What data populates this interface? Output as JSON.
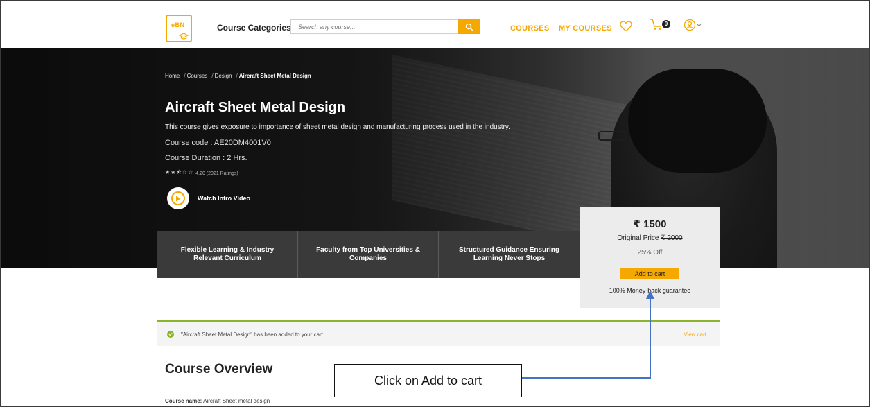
{
  "header": {
    "logo_text": "eBN",
    "categories_label": "Course Categories",
    "search_placeholder": "Search any course...",
    "nav_courses": "COURSES",
    "nav_my_courses": "MY COURSES",
    "cart_count": "0"
  },
  "breadcrumb": {
    "items": [
      "Home",
      "Courses",
      "Design"
    ],
    "current": "Aircraft Sheet Metal Design"
  },
  "course": {
    "title": "Aircraft Sheet Metal Design",
    "description": "This course gives exposure to importance of sheet metal design and manufacturing process used in the industry.",
    "code": "Course code : AE20DM4001V0",
    "duration": "Course Duration : 2 Hrs.",
    "stars": "★★⯪☆☆",
    "rating_value": 2.5,
    "rating_text": "4.20 (2021 Ratings)",
    "watch_label": "Watch Intro Video"
  },
  "features": [
    "Flexible Learning & Industry Relevant Curriculum",
    "Faculty from Top Universities & Companies",
    "Structured Guidance Ensuring Learning Never Stops"
  ],
  "price": {
    "current": "₹ 1500",
    "original_label": "Original Price",
    "original_value": "₹ 2000",
    "discount": "25% Off",
    "add_to_cart": "Add to cart",
    "guarantee": "100% Money-back guarantee"
  },
  "notice": {
    "text": "\"Aircraft Sheet Metal Design\" has been added to your cart.",
    "view_cart": "View cart"
  },
  "overview": {
    "title": "Course Overview",
    "course_name_key": "Course name:",
    "course_name_value": "Aircraft Sheet metal design"
  },
  "annotation": {
    "text": "Click on Add to cart"
  },
  "colors": {
    "accent": "#f5a800",
    "success": "#8ab42c",
    "arrow": "#4472c4"
  }
}
